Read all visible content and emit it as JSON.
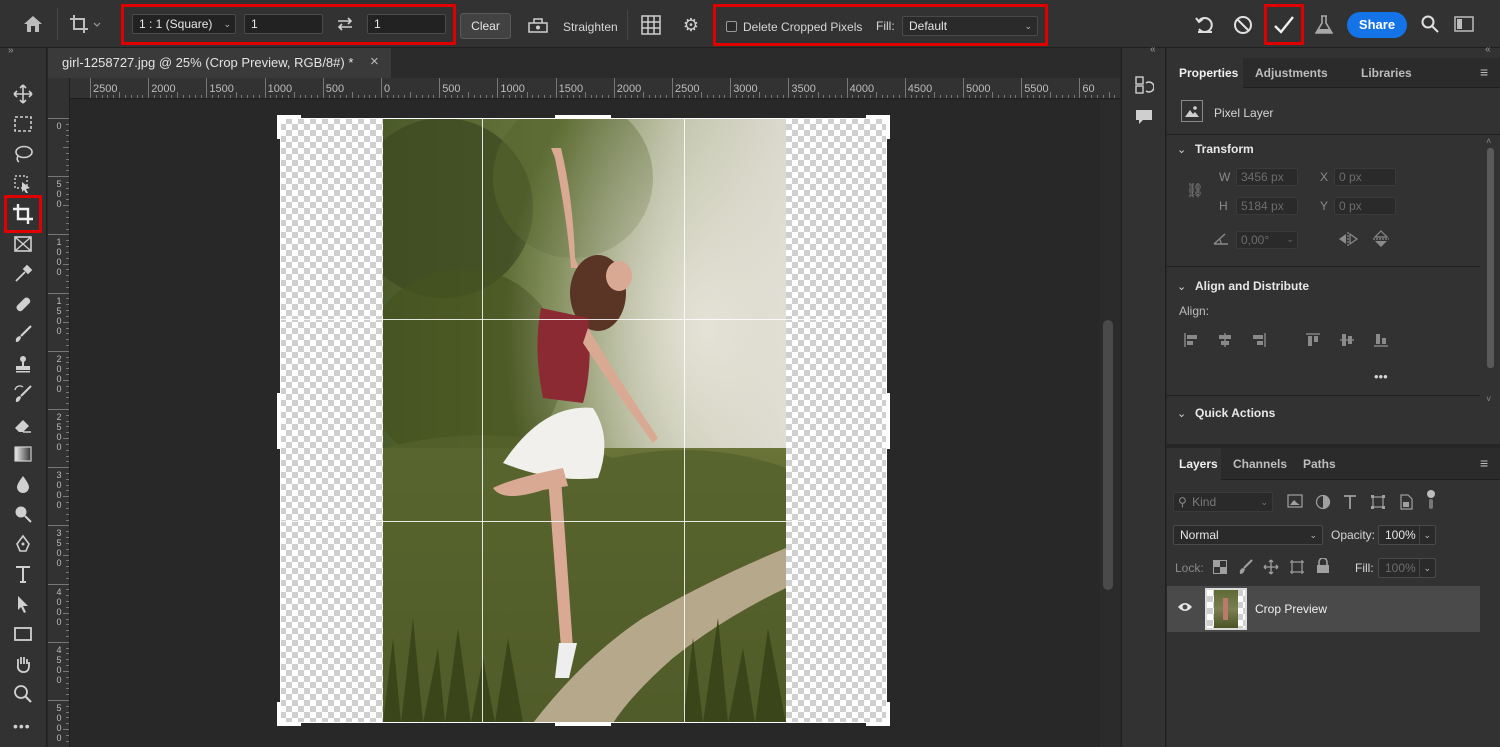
{
  "options_bar": {
    "ratio_preset": "1 : 1 (Square)",
    "width_value": "1",
    "height_value": "1",
    "clear_label": "Clear",
    "straighten_label": "Straighten",
    "delete_cropped_label": "Delete Cropped Pixels",
    "fill_label": "Fill:",
    "fill_value": "Default",
    "share_label": "Share",
    "share_color": "#1473e6",
    "highlight_color": "#e00000"
  },
  "document": {
    "tab_title": "girl-1258727.jpg @ 25% (Crop Preview, RGB/8#) *",
    "close_glyph": "×"
  },
  "rulers": {
    "horizontal": [
      "2500",
      "2000",
      "1500",
      "1000",
      "500",
      "0",
      "500",
      "1000",
      "1500",
      "2000",
      "2500",
      "3000",
      "3500",
      "4000",
      "4500",
      "5000",
      "5500",
      "60"
    ],
    "vertical": [
      "0",
      "500",
      "1000",
      "1500",
      "2000",
      "2500",
      "3000",
      "3500",
      "4000",
      "4500",
      "5000"
    ]
  },
  "properties": {
    "tabs": [
      "Properties",
      "Adjustments",
      "Libraries"
    ],
    "layer_type": "Pixel Layer",
    "transform": {
      "title": "Transform",
      "w_label": "W",
      "w_value": "3456 px",
      "h_label": "H",
      "h_value": "5184 px",
      "x_label": "X",
      "x_value": "0 px",
      "y_label": "Y",
      "y_value": "0 px",
      "angle_value": "0,00°"
    },
    "align": {
      "title": "Align and Distribute",
      "label": "Align:",
      "more": "•••"
    },
    "quick_actions": {
      "title": "Quick Actions"
    }
  },
  "layers": {
    "tabs": [
      "Layers",
      "Channels",
      "Paths"
    ],
    "kind_placeholder": "Kind",
    "blend_mode": "Normal",
    "opacity_label": "Opacity:",
    "opacity_value": "100%",
    "lock_label": "Lock:",
    "fill_label": "Fill:",
    "fill_value": "100%",
    "items": [
      {
        "name": "Crop Preview",
        "visible": true
      }
    ]
  },
  "icons": {
    "home": "home-icon",
    "crop": "crop-tool-icon",
    "swap": "swap-icon",
    "commit": "checkmark-icon",
    "cancel": "cancel-icon",
    "undo": "reset-icon"
  }
}
